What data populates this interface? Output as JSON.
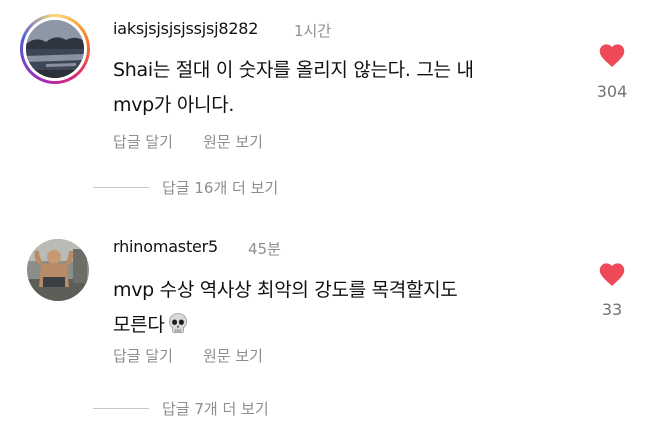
{
  "comments": [
    {
      "username": "iaksjsjsjsjssjsj8282",
      "time": "1시간",
      "lines": [
        "Shai는 절대 이 숫자를 올리지 않는다. 그는 내",
        "mvp가 아니다."
      ],
      "emoji": "",
      "reply_label": "답글 달기",
      "translate_label": "원문 보기",
      "view_replies_label": "답글 16개 더 보기",
      "likes": "304",
      "avatar_icon": "lake-landscape-avatar"
    },
    {
      "username": "rhinomaster5",
      "time": "45분",
      "lines": [
        "mvp 수상 역사상 최악의 강도를 목격할지도",
        "모른다"
      ],
      "emoji": "💀",
      "reply_label": "답글 달기",
      "translate_label": "원문 보기",
      "view_replies_label": "답글 7개 더 보기",
      "likes": "33",
      "avatar_icon": "person-flexing-avatar"
    }
  ],
  "colors": {
    "heart": "#ed4956",
    "meta_text": "#8e8e8e",
    "primary_text": "#111111",
    "story_ring": [
      "#feda75",
      "#fa7e1e",
      "#d62976",
      "#962fbf"
    ]
  }
}
